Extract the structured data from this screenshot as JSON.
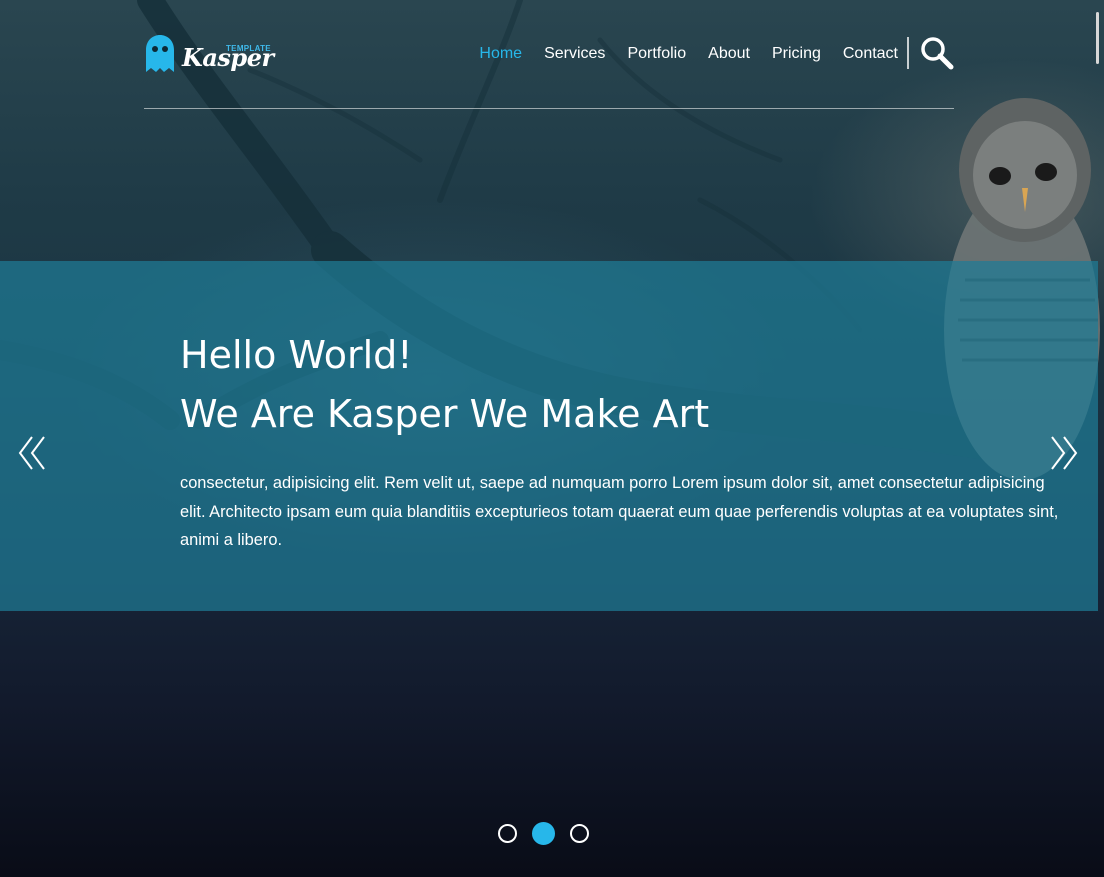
{
  "brand": {
    "logo_word": "Kasper",
    "logo_tag": "TEMPLATE",
    "accent_color": "#27b7ea"
  },
  "nav": {
    "items": [
      {
        "label": "Home",
        "active": true
      },
      {
        "label": "Services",
        "active": false
      },
      {
        "label": "Portfolio",
        "active": false
      },
      {
        "label": "About",
        "active": false
      },
      {
        "label": "Pricing",
        "active": false
      },
      {
        "label": "Contact",
        "active": false
      }
    ],
    "search_icon": "search-icon"
  },
  "slider": {
    "headline_1": "Hello World!",
    "headline_2": "We Are Kasper We Make Art",
    "body": "consectetur, adipisicing elit. Rem velit ut, saepe ad numquam porro Lorem ipsum dolor sit, amet consectetur adipisicing elit. Architecto ipsam eum quia blanditiis excepturieos totam quaerat eum quae perferendis voluptas at ea voluptates sint, animi a libero.",
    "prev_icon": "double-chevron-left-icon",
    "next_icon": "double-chevron-right-icon",
    "dots_total": 3,
    "active_dot": 2
  }
}
